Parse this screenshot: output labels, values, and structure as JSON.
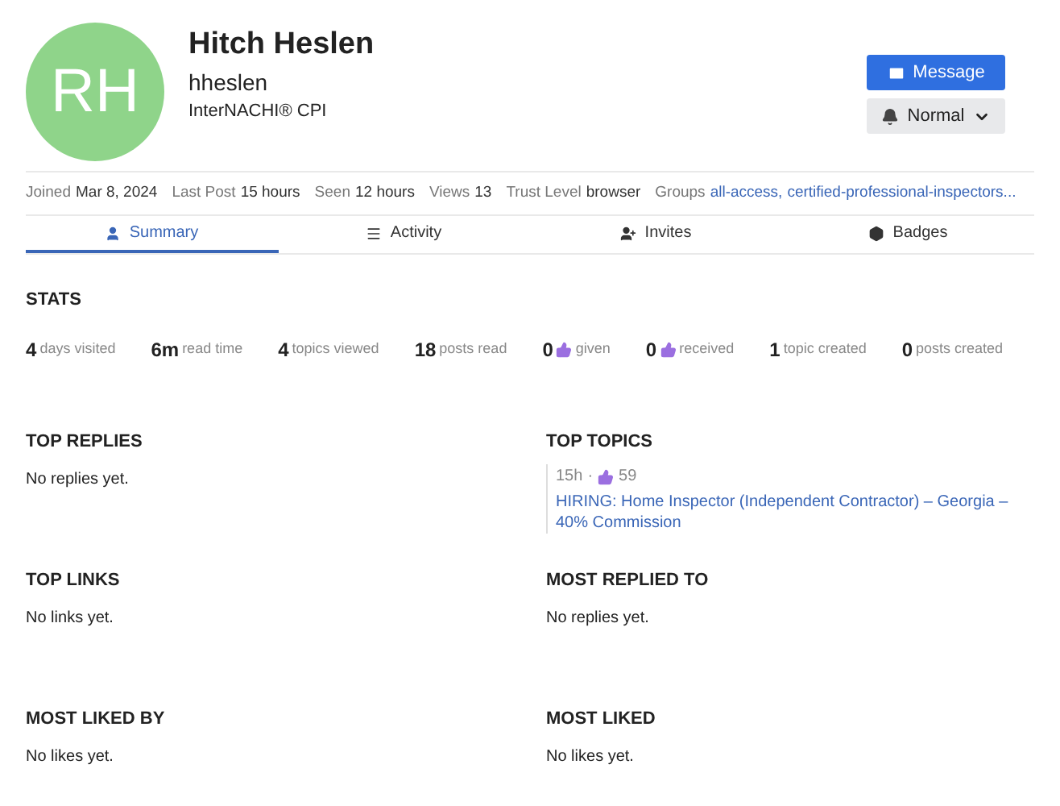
{
  "profile": {
    "initials": "RH",
    "name": "Hitch Heslen",
    "username": "hheslen",
    "title": "InterNACHI® CPI"
  },
  "actions": [
    {
      "kind": "primary",
      "label": "Message"
    },
    {
      "kind": "dropdown",
      "label": "Normal"
    }
  ],
  "meta": [
    {
      "label": "Joined",
      "value": "Mar 8, 2024"
    },
    {
      "label": "Last Post",
      "value": "15 hours"
    },
    {
      "label": "Seen",
      "value": "12 hours"
    },
    {
      "label": "Views",
      "value": "13"
    },
    {
      "label": "Trust Level",
      "value": "browser"
    },
    {
      "label": "Groups",
      "links": [
        "all-access,",
        "certified-professional-inspectors..."
      ]
    }
  ],
  "tabs": [
    {
      "label": "Summary",
      "selected": true
    },
    {
      "label": "Activity",
      "selected": false
    },
    {
      "label": "Invites",
      "selected": false
    },
    {
      "label": "Badges",
      "selected": false
    }
  ],
  "stats": {
    "title": "STATS",
    "items": [
      {
        "kind": "plain",
        "value": "4",
        "label": "days visited"
      },
      {
        "kind": "plain",
        "value": "6m",
        "label": "read time"
      },
      {
        "kind": "plain",
        "value": "4",
        "label": "topics viewed"
      },
      {
        "kind": "plain",
        "value": "18",
        "label": "posts read"
      },
      {
        "kind": "like",
        "value": "0",
        "label": "given"
      },
      {
        "kind": "like",
        "value": "0",
        "label": "received"
      },
      {
        "kind": "plain",
        "value": "1",
        "label": "topic created"
      },
      {
        "kind": "plain",
        "value": "0",
        "label": "posts created"
      }
    ]
  },
  "sections": [
    {
      "kind": "empty",
      "title": "TOP REPLIES",
      "text": "No replies yet."
    },
    {
      "kind": "topics",
      "title": "TOP TOPICS",
      "topics": [
        {
          "age": "15h",
          "dot": "·",
          "likes": "59",
          "title": "HIRING: Home Inspector (Independent Contractor) – Georgia – 40% Commission"
        }
      ]
    },
    {
      "kind": "empty",
      "title": "TOP LINKS",
      "text": "No links yet."
    },
    {
      "kind": "empty",
      "title": "MOST REPLIED TO",
      "text": "No replies yet."
    },
    {
      "kind": "empty",
      "title": "MOST LIKED BY",
      "text": "No likes yet."
    },
    {
      "kind": "empty",
      "title": "MOST LIKED",
      "text": "No likes yet."
    }
  ]
}
